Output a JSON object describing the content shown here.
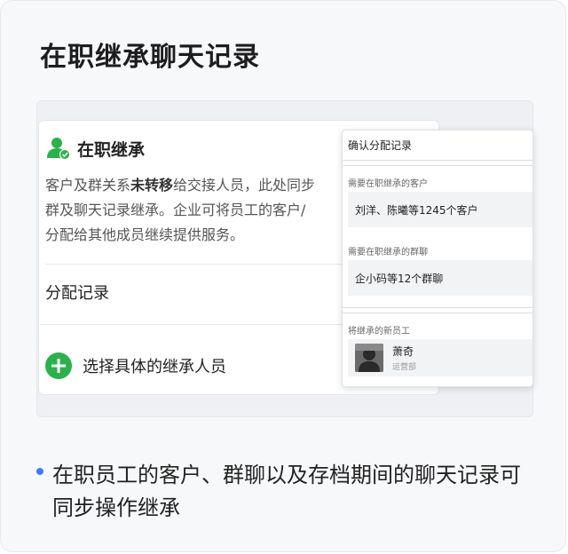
{
  "page": {
    "title": "在职继承聊天记录"
  },
  "inner": {
    "title": "在职继承",
    "desc_before": "客户及群关系",
    "desc_bold": "未转移",
    "desc_after": "给交接人员，此处同步\n群及聊天记录继承。企业可将员工的客户/\n分配给其他成员继续提供服务。",
    "allocation_label": "分配记录",
    "select_label": "选择具体的继承人员"
  },
  "confirm": {
    "title": "确认分配记录",
    "customers_label": "需要在职继承的客户",
    "customers_value": "刘洋、陈曦等1245个客户",
    "groups_label": "需要在职继承的群聊",
    "groups_value": "企小码等12个群聊",
    "employee_label": "将继承的新员工",
    "employee_name": "萧奇",
    "employee_dept": "运营部"
  },
  "note": {
    "text": "在职员工的客户、群聊以及存档期间的聊天记录可同步操作继承"
  },
  "colors": {
    "accent_green": "#2bb14b",
    "bullet_blue": "#3b7cff"
  }
}
